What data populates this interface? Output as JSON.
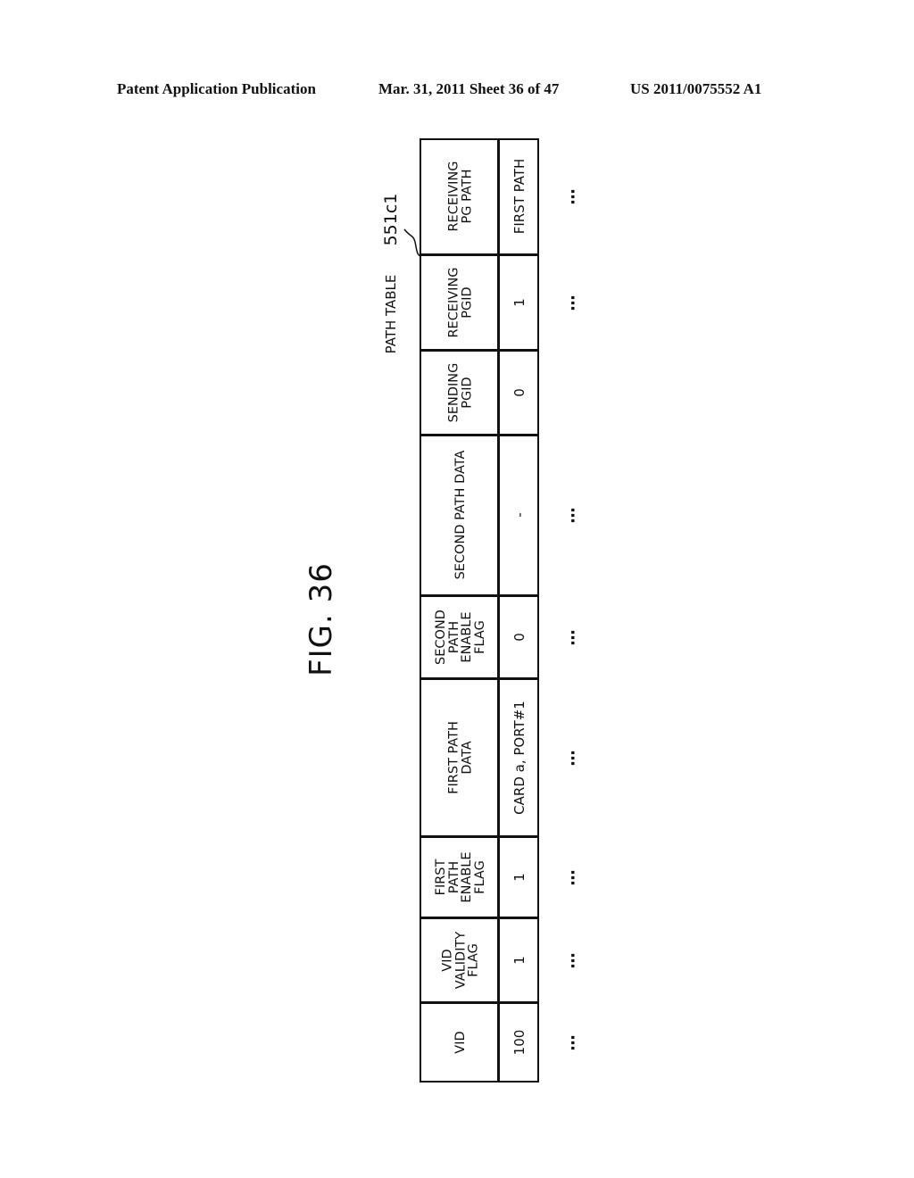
{
  "header": {
    "publication": "Patent Application Publication",
    "date_sheet": "Mar. 31, 2011  Sheet 36 of 47",
    "patent_number": "US 2011/0075552 A1"
  },
  "figure": {
    "label": "FIG. 36",
    "table_title": "PATH TABLE",
    "reference_numeral": "551c1"
  },
  "table": {
    "columns": [
      {
        "header": "VID",
        "value": "100",
        "continuation": "..."
      },
      {
        "header": "VID\nVALIDITY\nFLAG",
        "value": "1",
        "continuation": "..."
      },
      {
        "header": "FIRST\nPATH\nENABLE\nFLAG",
        "value": "1",
        "continuation": "..."
      },
      {
        "header": "FIRST PATH\nDATA",
        "value": "CARD a, PORT#1",
        "continuation": "..."
      },
      {
        "header": "SECOND\nPATH\nENABLE\nFLAG",
        "value": "0",
        "continuation": "..."
      },
      {
        "header": "SECOND PATH DATA",
        "value": "-",
        "continuation": "..."
      },
      {
        "header": "SENDING\nPGID",
        "value": "0",
        "continuation": ""
      },
      {
        "header": "RECEIVING\nPGID",
        "value": "1",
        "continuation": "..."
      },
      {
        "header": "RECEIVING\nPG PATH",
        "value": "FIRST PATH",
        "continuation": "..."
      }
    ]
  }
}
